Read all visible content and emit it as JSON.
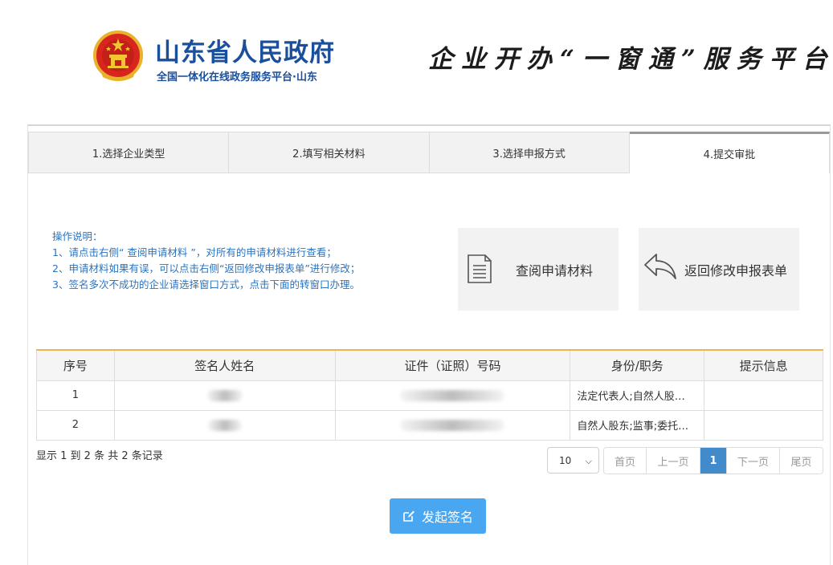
{
  "header": {
    "gov_title": "山东省人民政府",
    "gov_subtitle": "全国一体化在线政务服务平台·山东",
    "platform_title": "企业开办“一窗通”服务平台",
    "emblem_icon": "national-emblem-icon"
  },
  "steps": [
    {
      "label": "1.选择企业类型",
      "active": false
    },
    {
      "label": "2.填写相关材料",
      "active": false
    },
    {
      "label": "3.选择申报方式",
      "active": false
    },
    {
      "label": "4.提交审批",
      "active": true
    }
  ],
  "instructions": {
    "title": "操作说明：",
    "lines": [
      "1、请点击右侧“ 查阅申请材料 ”，对所有的申请材料进行查看；",
      "2、申请材料如果有误，可以点击右侧“返回修改申报表单”进行修改；",
      "3、签名多次不成功的企业请选择窗口方式，点击下面的转窗口办理。"
    ]
  },
  "cards": {
    "view": {
      "label": "查阅申请材料",
      "icon": "document-icon"
    },
    "back": {
      "label": "返回修改申报表单",
      "icon": "return-arrow-icon"
    }
  },
  "table": {
    "headers": [
      "序号",
      "签名人姓名",
      "证件（证照）号码",
      "身份/职务",
      "提示信息"
    ],
    "rows": [
      {
        "index": "1",
        "role": "法定代表人;自然人股…",
        "tip": ""
      },
      {
        "index": "2",
        "role": "自然人股东;监事;委托…",
        "tip": ""
      }
    ]
  },
  "pagination": {
    "record_info": "显示 1 到 2 条 共 2 条记录",
    "page_size": "10",
    "first": "首页",
    "prev": "上一页",
    "current": "1",
    "next": "下一页",
    "last": "尾页"
  },
  "sign_button": {
    "label": "发起签名",
    "icon": "edit-icon"
  },
  "colors": {
    "brand_blue": "#1a4f9c",
    "instruction_blue": "#2a74c2",
    "table_accent": "#f0b54d",
    "pager_active": "#428bca",
    "button_blue": "#49a6f0"
  }
}
